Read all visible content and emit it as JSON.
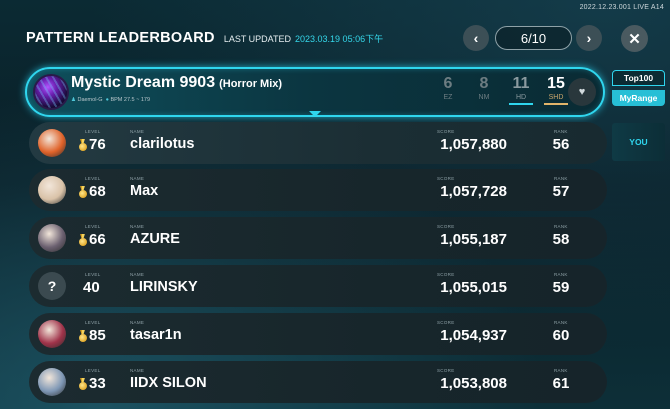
{
  "version": "2022.12.23.001 LIVE A14",
  "header": {
    "title": "PATTERN LEADERBOARD",
    "updated_label": "LAST UPDATED",
    "updated_value": "2023.03.19 05:06下午"
  },
  "pager": {
    "current": "6/10",
    "prev": "‹",
    "next": "›",
    "close": "✕"
  },
  "song": {
    "title": "Mystic Dream 9903",
    "subtitle": "(Horror Mix)",
    "artist": "Daemol-G",
    "bpm": "BPM 27.5 ~ 179",
    "difficulties": [
      {
        "level": "6",
        "name": "EZ"
      },
      {
        "level": "8",
        "name": "NM"
      },
      {
        "level": "11",
        "name": "HD"
      },
      {
        "level": "15",
        "name": "SHD"
      }
    ],
    "fav_icon": "♥"
  },
  "tabs": {
    "top": "Top100",
    "my": "MyRange"
  },
  "you_label": "YOU",
  "columns": {
    "level": "LEVEL",
    "name": "NAME",
    "score": "SCORE",
    "rank": "RANK"
  },
  "rows": [
    {
      "level": "76",
      "name": "clarilotus",
      "score": "1,057,880",
      "rank": "56",
      "medal": true,
      "avatar": "#e0632a"
    },
    {
      "level": "68",
      "name": "Max",
      "score": "1,057,728",
      "rank": "57",
      "medal": true,
      "avatar": "#d9c2a8"
    },
    {
      "level": "66",
      "name": "AZURE",
      "score": "1,055,187",
      "rank": "58",
      "medal": true,
      "avatar": "#6b6070"
    },
    {
      "level": "40",
      "name": "LIRINSKY",
      "score": "1,055,015",
      "rank": "59",
      "medal": false,
      "avatar": "?"
    },
    {
      "level": "85",
      "name": "tasar1n",
      "score": "1,054,937",
      "rank": "60",
      "medal": true,
      "avatar": "#a0334a"
    },
    {
      "level": "33",
      "name": "IIDX SILON",
      "score": "1,053,808",
      "rank": "61",
      "medal": true,
      "avatar": "#7e97b5"
    }
  ]
}
